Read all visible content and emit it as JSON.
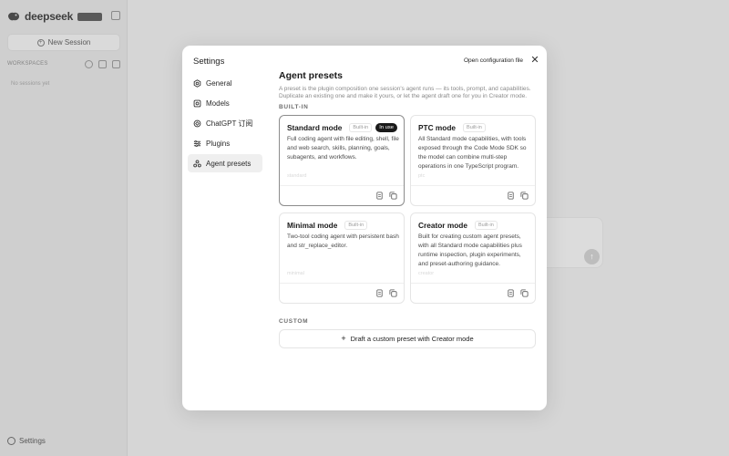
{
  "app": {
    "brand_name": "deepseek",
    "brand_badge": "",
    "new_session_label": "New Session",
    "workspace_label": "WORKSPACES",
    "empty_sessions": "No sessions yet",
    "settings_label": "Settings"
  },
  "modal": {
    "title": "Settings",
    "open_config_label": "Open configuration file",
    "close_icon": "close-icon",
    "nav": [
      {
        "label": "General",
        "icon": "gear-icon",
        "active": false
      },
      {
        "label": "Models",
        "icon": "models-icon",
        "active": false
      },
      {
        "label": "ChatGPT 订阅",
        "icon": "openai-icon",
        "active": false
      },
      {
        "label": "Plugins",
        "icon": "sliders-icon",
        "active": false
      },
      {
        "label": "Agent presets",
        "icon": "preset-icon",
        "active": true
      }
    ],
    "section": {
      "title": "Agent presets",
      "description": "A preset is the plugin composition one session's agent runs — its tools, prompt, and capabilities. Duplicate an existing one and make it yours, or let the agent draft one for you in Creator mode.",
      "builtin_label": "BUILT-IN",
      "custom_label": "CUSTOM"
    },
    "presets": [
      {
        "name": "Standard mode",
        "badge": "Built-in",
        "in_use": "In use",
        "description": "Full coding agent with file editing, shell, file and web search, skills, planning, goals, subagents, and workflows.",
        "ghost": "standard",
        "selected": true
      },
      {
        "name": "PTC mode",
        "badge": "Built-in",
        "in_use": "",
        "description": "All Standard mode capabilities, with tools exposed through the Code Mode SDK so the model can combine multi-step operations in one TypeScript program.",
        "ghost": "ptc",
        "selected": false
      },
      {
        "name": "Minimal mode",
        "badge": "Built-in",
        "in_use": "",
        "description": "Two-tool coding agent with persistent bash and str_replace_editor.",
        "ghost": "minimal",
        "selected": false
      },
      {
        "name": "Creator mode",
        "badge": "Built-in",
        "in_use": "",
        "description": "Built for creating custom agent presets, with all Standard mode capabilities plus runtime inspection, plugin experiments, and preset-authoring guidance.",
        "ghost": "creator",
        "selected": false
      }
    ],
    "custom_button_label": "Draft a custom preset with Creator mode"
  }
}
